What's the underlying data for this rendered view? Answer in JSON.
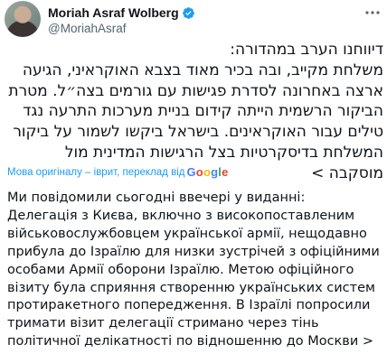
{
  "author": {
    "name": "Moriah Asraf Wolberg",
    "handle": "@MoriahAsraf"
  },
  "tweet": {
    "original_text": "דיווחנו הערב במהדורה:\nמשלחת מקייב, ובה בכיר מאוד בצבא האוקראיני, הגיעה\nארצה באחרונה לסדרת פגישות עם גורמים בצה״ל. מטרת\nהביקור הרשמית הייתה קידום בניית מערכות התרעה נגד\nטילים עבור האוקראינים. בישראל ביקשו לשמור על ביקור\nהמשלחת בדיסקרטיות בצל הרגישות המדינית מול\nמוסקבה >",
    "translation_note": "Мова оригіналу – іврит, переклад від",
    "translation_provider": "Google",
    "translated_text": "Ми повідомили сьогодні ввечері у виданні:\nДелегація з Києва, включно з високопоставленим\nвійськовослужбовцем української армії, нещодавно\nприбула до Ізраїлю для низки зустрічей з офіційними\nособами Армії оборони Ізраїлю. Метою офіційного\nвізиту була сприяння створенню українських систем\nпротиракетного попередження. В Ізраїлі попросили\nтримати візит делегації стримано через тінь\nполітичної делікатності по відношенню до Москви >"
  },
  "icons": {
    "verified": "verified-badge-icon",
    "more": "more-options-icon"
  },
  "colors": {
    "accent": "#1d9bf0",
    "text": "#0f1419",
    "muted": "#536471"
  }
}
